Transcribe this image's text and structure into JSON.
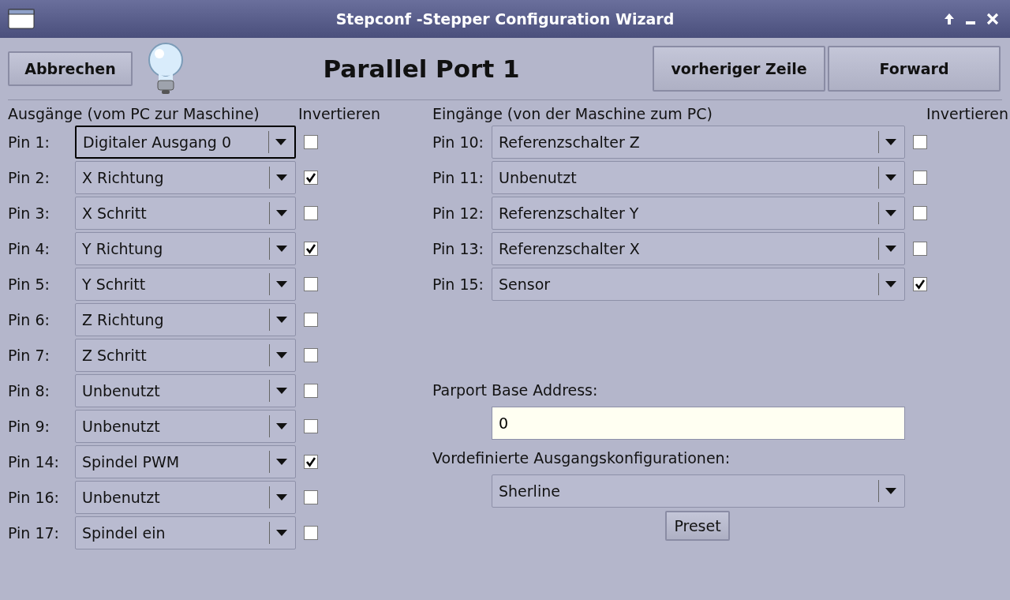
{
  "window": {
    "title": "Stepconf -Stepper Configuration Wizard"
  },
  "toolbar": {
    "cancel_button": "Abbrechen",
    "heading": "Parallel Port 1",
    "back_button": "vorheriger Zeile",
    "forward_button": "Forward"
  },
  "outputs": {
    "heading": "Ausgänge (vom PC zur Maschine)",
    "invert_heading": "Invertieren",
    "pins": [
      {
        "label": "Pin 1:",
        "value": "Digitaler Ausgang 0",
        "inverted": false,
        "focused": true
      },
      {
        "label": "Pin 2:",
        "value": "X Richtung",
        "inverted": true,
        "focused": false
      },
      {
        "label": "Pin 3:",
        "value": "X Schritt",
        "inverted": false,
        "focused": false
      },
      {
        "label": "Pin 4:",
        "value": "Y Richtung",
        "inverted": true,
        "focused": false
      },
      {
        "label": "Pin 5:",
        "value": "Y Schritt",
        "inverted": false,
        "focused": false
      },
      {
        "label": "Pin 6:",
        "value": "Z Richtung",
        "inverted": false,
        "focused": false
      },
      {
        "label": "Pin 7:",
        "value": "Z Schritt",
        "inverted": false,
        "focused": false
      },
      {
        "label": "Pin 8:",
        "value": "Unbenutzt",
        "inverted": false,
        "focused": false
      },
      {
        "label": "Pin 9:",
        "value": "Unbenutzt",
        "inverted": false,
        "focused": false
      },
      {
        "label": "Pin 14:",
        "value": "Spindel PWM",
        "inverted": true,
        "focused": false
      },
      {
        "label": "Pin 16:",
        "value": "Unbenutzt",
        "inverted": false,
        "focused": false
      },
      {
        "label": "Pin 17:",
        "value": "Spindel ein",
        "inverted": false,
        "focused": false
      }
    ]
  },
  "inputs": {
    "heading": "Eingänge (von der Maschine zum PC)",
    "invert_heading": "Invertieren",
    "pins": [
      {
        "label": "Pin 10:",
        "value": "Referenzschalter Z",
        "inverted": false,
        "focused": false
      },
      {
        "label": "Pin 11:",
        "value": "Unbenutzt",
        "inverted": false,
        "focused": false
      },
      {
        "label": "Pin 12:",
        "value": "Referenzschalter Y",
        "inverted": false,
        "focused": false
      },
      {
        "label": "Pin 13:",
        "value": "Referenzschalter X",
        "inverted": false,
        "focused": false
      },
      {
        "label": "Pin 15:",
        "value": "Sensor",
        "inverted": true,
        "focused": false
      }
    ]
  },
  "base_address": {
    "label": "Parport Base Address:",
    "value": "0"
  },
  "presets": {
    "label": "Vordefinierte Ausgangskonfigurationen:",
    "value": "Sherline",
    "button": "Preset"
  }
}
